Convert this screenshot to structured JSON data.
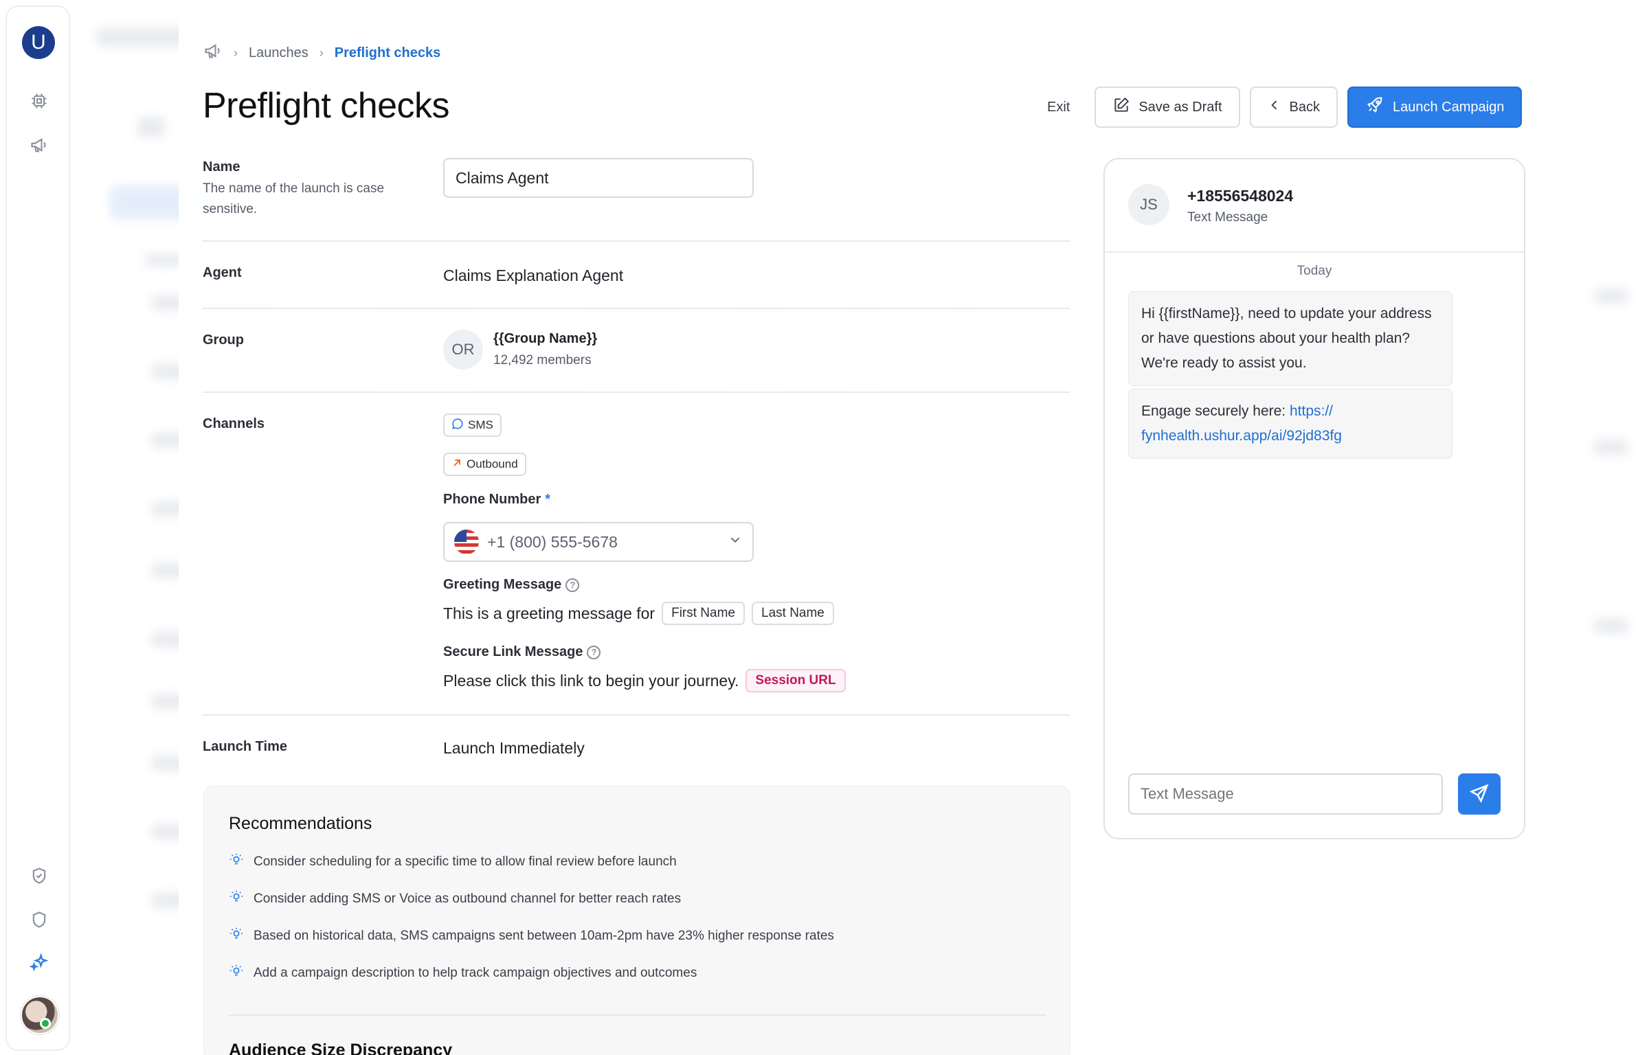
{
  "breadcrumb": {
    "items": [
      "Launches",
      "Preflight checks"
    ]
  },
  "page": {
    "title": "Preflight checks"
  },
  "toolbar": {
    "exit_label": "Exit",
    "save_label": "Save as Draft",
    "back_label": "Back",
    "launch_label": "Launch Campaign"
  },
  "form": {
    "name": {
      "label": "Name",
      "description": "The name of the launch is case sensitive.",
      "value": "Claims Agent"
    },
    "agent": {
      "label": "Agent",
      "value": "Claims Explanation Agent"
    },
    "group": {
      "label": "Group",
      "initials": "OR",
      "name": "{{Group Name}}",
      "members": "12,492 members"
    },
    "channels": {
      "label": "Channels",
      "chips": [
        "SMS",
        "Outbound"
      ],
      "phone_label": "Phone Number",
      "phone_required": "*",
      "phone_value": "+1 (800) 555-5678",
      "greeting_label": "Greeting Message",
      "greeting_text": "This is a greeting message for",
      "greeting_tags": [
        "First Name",
        "Last Name"
      ],
      "secure_label": "Secure Link Message",
      "secure_text": "Please click this link to begin your journey.",
      "secure_tag": "Session URL"
    },
    "launch_time": {
      "label": "Launch Time",
      "value": "Launch Immediately"
    }
  },
  "recommendations": {
    "title": "Recommendations",
    "items": [
      "Consider scheduling for a specific time to allow final review before launch",
      "Consider adding SMS or Voice as outbound channel for better reach rates",
      "Based on historical data, SMS campaigns sent between 10am-2pm have 23% higher response rates",
      "Add a campaign description to help track campaign objectives and outcomes"
    ],
    "next_title": "Audience Size Discrepancy"
  },
  "preview": {
    "initials": "JS",
    "number": "+18556548024",
    "type": "Text Message",
    "day": "Today",
    "message1": "Hi {{firstName}}, need to update your address or have questions about your health plan? We're ready to assist you.",
    "message2_prefix": "Engage securely here: ",
    "message2_link": "https:// fynhealth.ushur.app/ai/92jd83fg",
    "input_placeholder": "Text Message"
  },
  "colors": {
    "accent": "#2b7de9",
    "brand": "#1c3d8c",
    "pink": "#c2185b"
  },
  "icons": {
    "sidebar": [
      "logo-u",
      "chip-icon",
      "megaphone-icon",
      "shield-check-icon",
      "shield-icon",
      "sparkle-icon"
    ],
    "breadcrumb_home": "megaphone-icon"
  }
}
